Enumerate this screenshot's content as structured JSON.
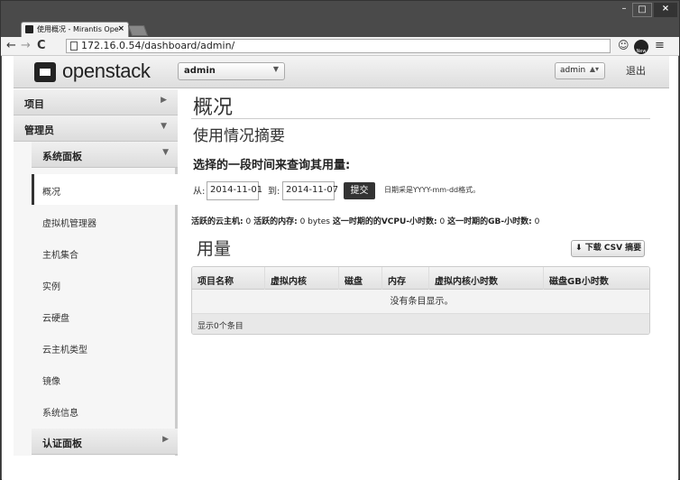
{
  "browser": {
    "tab_title": "使用概况 - Mirantis Ope",
    "tab_close": "×",
    "url": "172.16.0.54/dashboard/admin/",
    "nav_back": "←",
    "nav_forward": "→",
    "nav_reload": "C",
    "new_badge": "New",
    "window_controls": {
      "minimize": "–",
      "maximize": "□",
      "close": "×"
    }
  },
  "header": {
    "brand": "openstack",
    "project_selected": "admin",
    "user_label": "admin",
    "logout_label": "退出"
  },
  "sidebar": {
    "sections": [
      {
        "label": "项目",
        "expanded": false
      },
      {
        "label": "管理员",
        "expanded": true
      }
    ],
    "panel_group": {
      "label": "系统面板",
      "expanded": true
    },
    "items": [
      {
        "label": "概况",
        "active": true
      },
      {
        "label": "虚拟机管理器",
        "active": false
      },
      {
        "label": "主机集合",
        "active": false
      },
      {
        "label": "实例",
        "active": false
      },
      {
        "label": "云硬盘",
        "active": false
      },
      {
        "label": "云主机类型",
        "active": false
      },
      {
        "label": "镜像",
        "active": false
      },
      {
        "label": "系统信息",
        "active": false
      }
    ],
    "identity_group": {
      "label": "认证面板",
      "expanded": false
    }
  },
  "main": {
    "title": "概况",
    "subtitle": "使用情况摘要",
    "query_heading": "选择的一段时间来查询其用量:",
    "from_label": "从:",
    "from_value": "2014-11-01",
    "to_label": "到:",
    "to_value": "2014-11-07",
    "submit_label": "提交",
    "date_hint": "日期采是YYYY-mm-dd格式。",
    "stats": [
      {
        "label": "活跃的云主机:",
        "value": "0"
      },
      {
        "label": "活跃的内存:",
        "value": "0 bytes"
      },
      {
        "label": "这一时期的的VCPU-小时数:",
        "value": "0"
      },
      {
        "label": "这一时期的GB-小时数:",
        "value": "0"
      }
    ],
    "usage_heading": "用量",
    "csv_button": "下载 CSV 摘要",
    "table": {
      "columns": [
        "项目名称",
        "虚拟内核",
        "磁盘",
        "内存",
        "虚拟内核小时数",
        "磁盘GB小时数"
      ],
      "empty_text": "没有条目显示。",
      "footer": "显示0个条目"
    }
  }
}
